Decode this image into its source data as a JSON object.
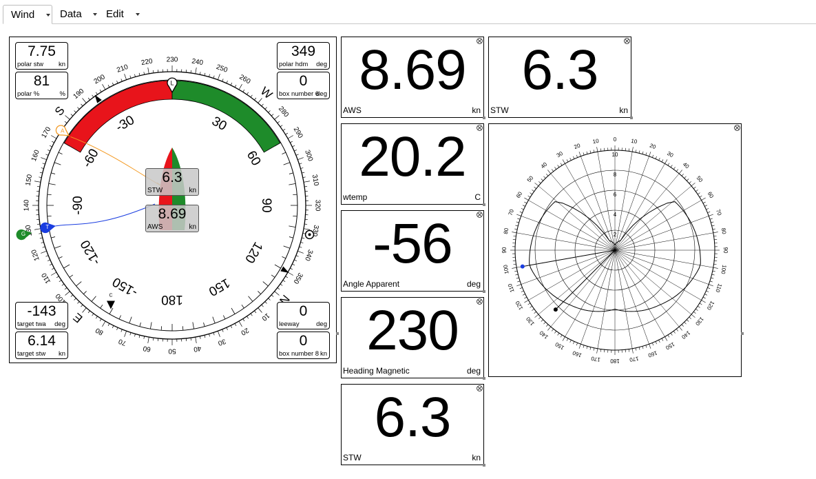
{
  "tabs": [
    {
      "label": "Wind",
      "active": true
    },
    {
      "label": "Data",
      "active": false
    },
    {
      "label": "Edit",
      "active": false
    }
  ],
  "gauge": {
    "heading": 230,
    "compass_labels": [
      "10",
      "20",
      "30",
      "40",
      "50",
      "60",
      "70",
      "80",
      "90",
      "100",
      "110",
      "120",
      "130",
      "140",
      "150",
      "160",
      "170",
      "180",
      "190",
      "200",
      "210",
      "220",
      "230",
      "240",
      "250",
      "260",
      "270",
      "280",
      "290",
      "300",
      "310",
      "320",
      "330",
      "340",
      "350"
    ],
    "cardinals": {
      "N": "N",
      "E": "E",
      "S": "S",
      "W": "W"
    },
    "relative_labels": [
      "-30",
      "30",
      "-60",
      "60",
      "-90",
      "90",
      "-120",
      "120",
      "-150",
      "150",
      "180"
    ],
    "markers": {
      "lubber": "L",
      "apparent": "A",
      "true": "T",
      "ground": "G",
      "other": "C"
    },
    "top_left": [
      {
        "value": "7.75",
        "label": "polar stw",
        "unit": "kn"
      },
      {
        "value": "81",
        "label": "polar %",
        "unit": "%"
      }
    ],
    "top_right": [
      {
        "value": "349",
        "label": "polar hdm",
        "unit": "deg"
      },
      {
        "value": "0",
        "label": "box number 6",
        "unit": "deg"
      }
    ],
    "bottom_left": [
      {
        "value": "-143",
        "label": "target twa",
        "unit": "deg"
      },
      {
        "value": "6.14",
        "label": "target stw",
        "unit": "kn"
      }
    ],
    "bottom_right": [
      {
        "value": "0",
        "label": "leeway",
        "unit": "deg"
      },
      {
        "value": "0",
        "label": "box number 8",
        "unit": "kn"
      }
    ],
    "center_boxes": [
      {
        "value": "6.3",
        "label": "STW",
        "unit": "kn"
      },
      {
        "value": "8.69",
        "label": "AWS",
        "unit": "kn"
      }
    ],
    "colors": {
      "port": "#e8141b",
      "starboard": "#1e8b2a",
      "apparent": "#f39a24",
      "true": "#1a3de0",
      "ground": "#1e8b2a"
    }
  },
  "displays": [
    {
      "value": "8.69",
      "label": "AWS",
      "unit": "kn"
    },
    {
      "value": "6.3",
      "label": "STW",
      "unit": "kn"
    },
    {
      "value": "20.2",
      "label": "wtemp",
      "unit": "C"
    },
    {
      "value": "-56",
      "label": "Angle Apparent",
      "unit": "deg"
    },
    {
      "value": "230",
      "label": "Heading Magnetic",
      "unit": "deg"
    },
    {
      "value": "6.3",
      "label": "STW",
      "unit": "kn"
    }
  ],
  "polar": {
    "angle_labels": [
      "0",
      "10",
      "20",
      "30",
      "40",
      "50",
      "60",
      "70",
      "80",
      "90",
      "100",
      "110",
      "120",
      "130",
      "140",
      "150",
      "160",
      "170",
      "180"
    ],
    "radial_labels": [
      "2",
      "4",
      "6",
      "8",
      "10"
    ],
    "points": {
      "blue_angle": 100,
      "blue_speed": 9.4,
      "black_angle": 135,
      "black_speed": 8.4
    }
  }
}
